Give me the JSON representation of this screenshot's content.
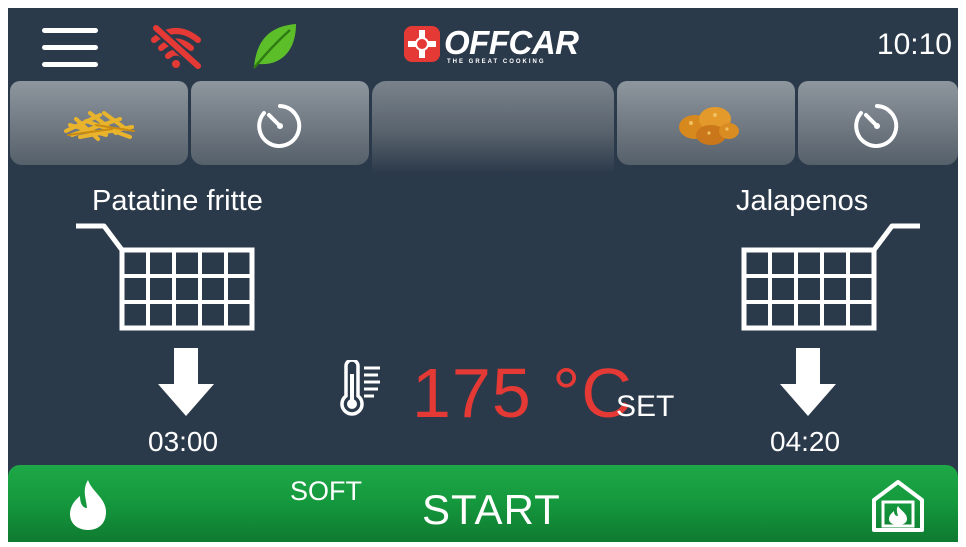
{
  "header": {
    "logo_text": "OFFCAR",
    "logo_tagline": "THE GREAT COOKING",
    "time": "10:10",
    "icons": [
      "menu-icon",
      "wifi-off-icon",
      "leaf-icon",
      "offcar-logo"
    ]
  },
  "tabs": [
    {
      "icon": "fries-icon"
    },
    {
      "icon": "timer-icon"
    },
    {
      "icon": "empty",
      "active": true
    },
    {
      "icon": "nuggets-icon"
    },
    {
      "icon": "timer-icon"
    }
  ],
  "left_basket": {
    "product": "Patatine fritte",
    "time": "03:00",
    "icon": "basket-icon",
    "arrow": "down-arrow-icon"
  },
  "right_basket": {
    "product": "Jalapenos",
    "time": "04:20",
    "icon": "basket-icon",
    "arrow": "down-arrow-icon"
  },
  "temperature": {
    "value": "175 °C",
    "label": "SET",
    "icon": "thermometer-icon"
  },
  "start_bar": {
    "mode": "SOFT",
    "label": "START",
    "icons": [
      "flame-icon",
      "gas-burner-icon"
    ]
  },
  "colors": {
    "background": "#2b3a4a",
    "accent_red": "#e53935",
    "start_green": "#159a3e",
    "wifi_off_red": "#e53935",
    "leaf_green": "#5cbf2a"
  }
}
